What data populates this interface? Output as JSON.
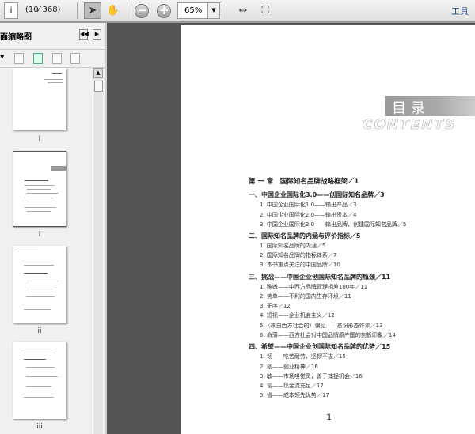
{
  "toolbar": {
    "page_input": "i",
    "page_count": "(10⁄ 368)",
    "zoom": "65%",
    "tools_label": "工具"
  },
  "sidebar": {
    "title": "面缩略图",
    "thumb_labels": [
      "I",
      "i",
      "ii",
      "iii"
    ]
  },
  "page": {
    "title_cn": "目录",
    "title_en": "CONTENTS",
    "toc": [
      {
        "t": "ch",
        "text": "第 一 章　国际知名品牌战略框架／1"
      },
      {
        "t": "sec",
        "text": "一、中国企业国际化3.0——创国际知名品牌／3"
      },
      {
        "t": "it",
        "text": "1. 中国企业国际化1.0——输出产品／3"
      },
      {
        "t": "it",
        "text": "2. 中国企业国际化2.0——输出资本／4"
      },
      {
        "t": "it",
        "text": "3. 中国企业国际化3.0——输出品牌，创建国际知名品牌／5"
      },
      {
        "t": "sec",
        "text": "二、国际知名品牌的内涵与评价指标／5"
      },
      {
        "t": "it",
        "text": "1. 国际知名品牌的内涵／5"
      },
      {
        "t": "it",
        "text": "2. 国际知名品牌的指标体系／7"
      },
      {
        "t": "it",
        "text": "3. 本书重点关注的中国品牌／10"
      },
      {
        "t": "sec",
        "text": "三、挑战——中国企业创国际知名品牌的瓶颈／11"
      },
      {
        "t": "it",
        "text": "1. 稚嫩——中西方品牌管理相差100年／11"
      },
      {
        "t": "it",
        "text": "2. 势单——不利的国内生存环境／11"
      },
      {
        "t": "it",
        "text": "3. 无序／12"
      },
      {
        "t": "it",
        "text": "4. 短视——企业机会主义／12"
      },
      {
        "t": "it",
        "text": "5.（来自西方社会的）偏见——意识形态作祟／13"
      },
      {
        "t": "it",
        "text": "6. 命薄——西方社会对中国品牌原产国的刻板印象／14"
      },
      {
        "t": "sec",
        "text": "四、希望——中国企业创国际知名品牌的优势／15"
      },
      {
        "t": "it",
        "text": "1. 韧——吃苦耐劳，坚韧不拔／15"
      },
      {
        "t": "it",
        "text": "2. 创——创业精神／16"
      },
      {
        "t": "it",
        "text": "3. 敏——市场嗅觉灵，善于捕捉机会／16"
      },
      {
        "t": "it",
        "text": "4. 富——现金流充足／17"
      },
      {
        "t": "it",
        "text": "5. 省——成本领先优势／17"
      }
    ],
    "page_number": "1"
  }
}
